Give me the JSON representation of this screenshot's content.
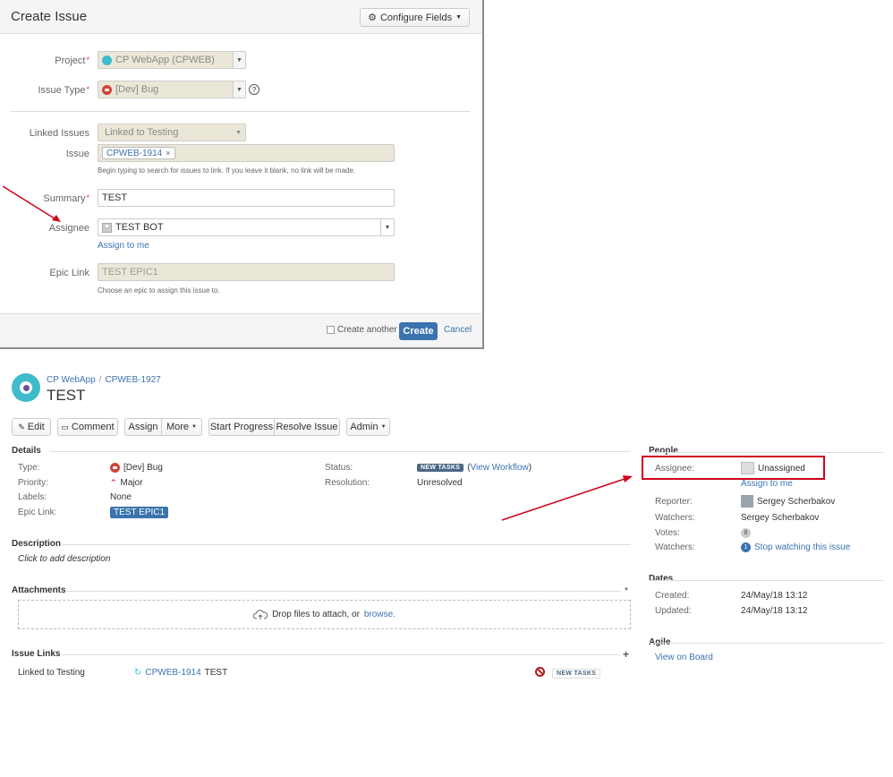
{
  "dialog": {
    "title": "Create Issue",
    "configure_fields": "Configure Fields",
    "project": {
      "label": "Project",
      "value": "CP WebApp (CPWEB)"
    },
    "issue_type": {
      "label": "Issue Type",
      "value": "[Dev] Bug"
    },
    "linked_issues": {
      "label": "Linked Issues",
      "value": "Linked to Testing"
    },
    "issue": {
      "label": "Issue",
      "chip": "CPWEB-1914",
      "chip_remove": "×",
      "hint": "Begin typing to search for issues to link. If you leave it blank, no link will be made."
    },
    "summary": {
      "label": "Summary",
      "value": "TEST"
    },
    "assignee": {
      "label": "Assignee",
      "value": "TEST BOT",
      "assign_to_me": "Assign to me"
    },
    "epic_link": {
      "label": "Epic Link",
      "value": "TEST EPIC1",
      "hint": "Choose an epic to assign this issue to."
    },
    "footer": {
      "create_another": "Create another",
      "create": "Create",
      "cancel": "Cancel"
    }
  },
  "issue": {
    "breadcrumb": {
      "project": "CP WebApp",
      "separator": "/",
      "key": "CPWEB-1927"
    },
    "title": "TEST",
    "toolbar": {
      "edit": "Edit",
      "comment": "Comment",
      "assign": "Assign",
      "more": "More",
      "start_progress": "Start Progress",
      "resolve_issue": "Resolve Issue",
      "admin": "Admin"
    },
    "details": {
      "heading": "Details",
      "type_label": "Type:",
      "type_value": "[Dev] Bug",
      "priority_label": "Priority:",
      "priority_value": "Major",
      "labels_label": "Labels:",
      "labels_value": "None",
      "epic_label": "Epic Link:",
      "epic_value": "TEST EPIC1",
      "status_label": "Status:",
      "status_value": "NEW TASKS",
      "status_open": "(",
      "view_workflow": "View Workflow",
      "status_close": ")",
      "resolution_label": "Resolution:",
      "resolution_value": "Unresolved"
    },
    "description": {
      "heading": "Description",
      "placeholder": "Click to add description"
    },
    "attachments": {
      "heading": "Attachments",
      "drop_text": "Drop files to attach, or",
      "browse": "browse."
    },
    "issue_links": {
      "heading": "Issue Links",
      "rows": [
        {
          "relation": "Linked to Testing",
          "key": "CPWEB-1914",
          "summary": "TEST",
          "status": "NEW TASKS"
        }
      ]
    },
    "people": {
      "heading": "People",
      "assignee_label": "Assignee:",
      "assignee_value": "Unassigned",
      "assign_to_me": "Assign to me",
      "reporter_label": "Reporter:",
      "reporter_value": "Sergey Scherbakov",
      "watchers_label": "Watchers:",
      "watchers_value": "Sergey Scherbakov",
      "votes_label": "Votes:",
      "votes_value": "0",
      "watching_label": "Watchers:",
      "watching_count": "1",
      "stop_watching": "Stop watching this issue"
    },
    "dates": {
      "heading": "Dates",
      "created_label": "Created:",
      "created_value": "24/May/18 13:12",
      "updated_label": "Updated:",
      "updated_value": "24/May/18 13:12"
    },
    "agile": {
      "heading": "Agile",
      "view_on_board": "View on Board"
    }
  },
  "colors": {
    "accent": "#3b73af",
    "annotation": "#d0021b",
    "lozenge": "#4a6785"
  }
}
